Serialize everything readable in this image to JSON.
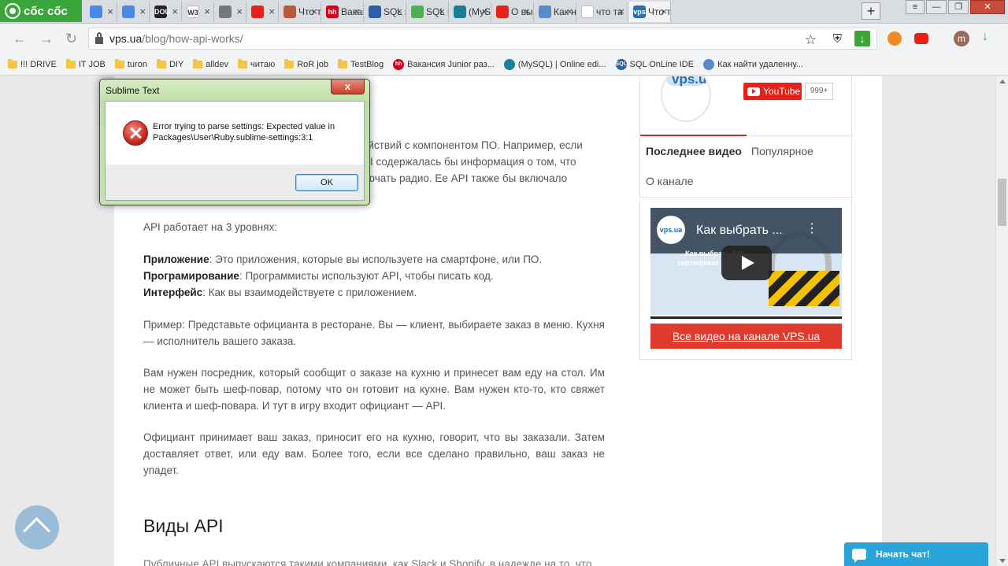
{
  "browser": {
    "brand": "cốc cốc",
    "tabs": [
      {
        "label": "",
        "icon": "google-translate-icon",
        "color": "#4a88e8"
      },
      {
        "label": "",
        "icon": "google-translate-icon",
        "color": "#4a88e8"
      },
      {
        "label": "",
        "icon": "dou-icon",
        "color": "#222222",
        "fav_text": "DOU"
      },
      {
        "label": "",
        "icon": "w3schools-icon",
        "color": "#ffffff",
        "fav_text": "W3"
      },
      {
        "label": "",
        "icon": "tab-icon",
        "color": "#777777"
      },
      {
        "label": "",
        "icon": "youtube-icon",
        "color": "#e62117"
      },
      {
        "label": "Что т",
        "icon": "avatar-icon",
        "color": "#b65a3c"
      },
      {
        "label": "Вакан",
        "icon": "hh-icon",
        "color": "#d6001c",
        "fav_text": "hh"
      },
      {
        "label": "SQL э",
        "icon": "sql-icon",
        "color": "#2c5fa8"
      },
      {
        "label": "SQL F",
        "icon": "w3-icon",
        "color": "#4caf50"
      },
      {
        "label": "(MySC",
        "icon": "mysql-icon",
        "color": "#1b7f9a"
      },
      {
        "label": "О выг",
        "icon": "youtube-icon",
        "color": "#e62117"
      },
      {
        "label": "Как н",
        "icon": "puzzle-icon",
        "color": "#5b8ac9"
      },
      {
        "label": "что та",
        "icon": "google-icon",
        "color": "#ffffff"
      },
      {
        "label": "Что т",
        "icon": "vps-icon",
        "color": "#2a6db0",
        "fav_text": "vps"
      }
    ],
    "new_tab": "+",
    "window_buttons": {
      "menu": "≡",
      "minimize": "—",
      "maximize": "❐",
      "close": "✕"
    },
    "url_host": "vps.ua",
    "url_path": "/blog/how-api-works/",
    "bookmarks": [
      {
        "label": "!!! DRIVE",
        "type": "folder"
      },
      {
        "label": "IT JOB",
        "type": "folder"
      },
      {
        "label": "turon",
        "type": "folder"
      },
      {
        "label": "DIY",
        "type": "folder"
      },
      {
        "label": "alldev",
        "type": "folder"
      },
      {
        "label": "читаю",
        "type": "folder"
      },
      {
        "label": "RoR job",
        "type": "folder"
      },
      {
        "label": "TestBlog",
        "type": "folder"
      },
      {
        "label": "Вакансия Junior раз...",
        "type": "site",
        "color": "#d6001c",
        "fav_text": "hh"
      },
      {
        "label": "(MySQL) | Online edi...",
        "type": "site",
        "color": "#1b7f9a"
      },
      {
        "label": "SQL OnLine IDE",
        "type": "site",
        "color": "#2c5fa8",
        "fav_text": "SQL"
      },
      {
        "label": "Как найти удаленну...",
        "type": "site",
        "color": "#5b8ac9"
      }
    ],
    "profile_initial": "m"
  },
  "article": {
    "para1_lines": [
      "действий с компонентом ПО. Например, если",
      "API содержалась бы информация о том, что",
      "ключать радио. Ее API также бы включало"
    ],
    "levels_intro": "API работает на 3 уровнях:",
    "levels": [
      {
        "term": "Приложение",
        "text": ": Это приложения, которые вы используете на смартфоне, или ПО."
      },
      {
        "term": "Програмирование",
        "text": ": Программисты используют API, чтобы писать код."
      },
      {
        "term": "Интерфейс",
        "text": ": Как вы взаимодействуете с приложением."
      }
    ],
    "example": "Пример: Представьте официанта в ресторане. Вы — клиент, выбираете заказ в меню. Кухня — исполнитель вашего заказа.",
    "middleman": "Вам нужен посредник, который сообщит о заказе на кухню и принесет вам еду на стол. Им не может быть шеф-повар, потому что он готовит на кухне. Вам нужен кто-то, кто свяжет клиента и шеф-повара. И тут в игру входит официант — API.",
    "waiter": "Официант принимает ваш заказ, приносит его на кухню, говорит, что вы заказали. Затем доставляет ответ, или еду вам. Более того, если все сделано правильно, ваш заказ не упадет.",
    "heading": "Виды API",
    "cut_line": "Публичные API выпускаются такими компаниями, как Slack и Shopify, в надежде на то, что"
  },
  "sidebar": {
    "logo_text": "vps.ua",
    "youtube_label": "YouTube",
    "subscriber_count": "999+",
    "tabs": [
      "Последнее видео",
      "Популярное",
      "О канале"
    ],
    "video_logo": "vps.ua",
    "video_title": "Как выбрать ...",
    "video_body": "Как выбрать SSL-сертификат для сайта",
    "all_videos": "Все видео на канале VPS.ua"
  },
  "chat": {
    "label": "Начать чат!"
  },
  "dialog": {
    "title": "Sublime Text",
    "close": "x",
    "message_line1": "Error trying to parse settings: Expected value in",
    "message_line2": "Packages\\User\\Ruby.sublime-settings:3:1",
    "ok": "OK"
  }
}
